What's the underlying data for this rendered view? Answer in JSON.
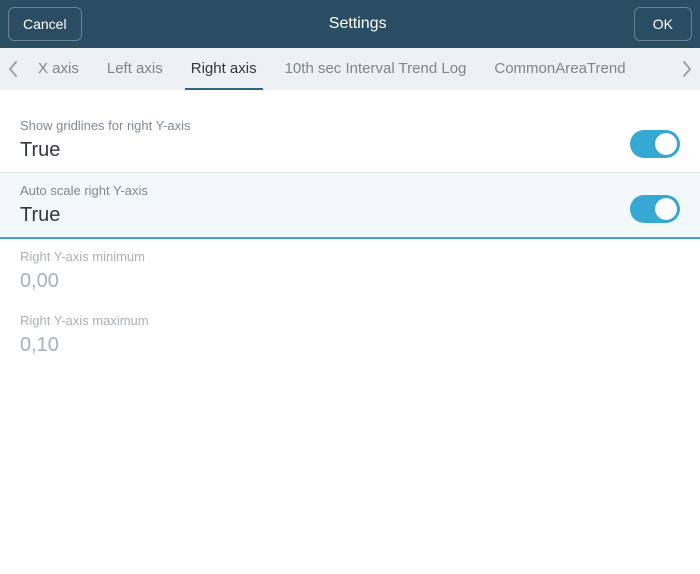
{
  "header": {
    "cancel": "Cancel",
    "title": "Settings",
    "ok": "OK"
  },
  "tabs": {
    "items": [
      {
        "label": "X axis"
      },
      {
        "label": "Left axis"
      },
      {
        "label": "Right axis"
      },
      {
        "label": "10th sec Interval Trend Log"
      },
      {
        "label": "CommonAreaTrend"
      }
    ],
    "active_index": 2
  },
  "settings": {
    "show_gridlines": {
      "label": "Show gridlines for right Y-axis",
      "value": "True",
      "on": true
    },
    "auto_scale": {
      "label": "Auto scale right Y-axis",
      "value": "True",
      "on": true
    },
    "min": {
      "label": "Right Y-axis minimum",
      "value": "0,00"
    },
    "max": {
      "label": "Right Y-axis maximum",
      "value": "0,10"
    }
  }
}
